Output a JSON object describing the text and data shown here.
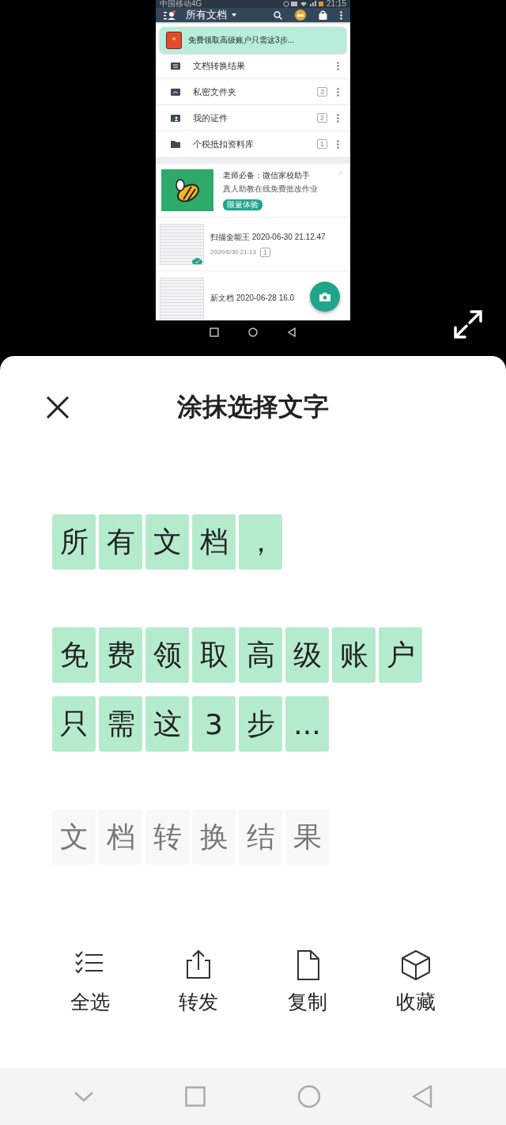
{
  "preview": {
    "status_bar": {
      "carrier": "中国移动4G",
      "time": "21:15"
    },
    "app_bar": {
      "title": "所有文档"
    },
    "promo": {
      "text": "免费领取高级账户只需这3步..."
    },
    "folders": [
      {
        "name": "文档转换结果",
        "kind": "convert"
      },
      {
        "name": "私密文件夹",
        "kind": "private",
        "count": "3"
      },
      {
        "name": "我的证件",
        "kind": "id",
        "count": "2"
      },
      {
        "name": "个税抵扣资料库",
        "kind": "folder",
        "count": "1"
      }
    ],
    "ad": {
      "title": "老师必备：微信家校助手",
      "subtitle": "真人助教在线免费批改作业",
      "button": "限量体验"
    },
    "documents": [
      {
        "title": "扫描全能王 2020-06-30 21.12.47",
        "meta": "2020/6/30 21:13",
        "count": "1",
        "synced": true
      },
      {
        "title": "新文档 2020-06-28 16.0",
        "synced": false
      }
    ]
  },
  "sheet": {
    "title": "涂抹选择文字",
    "paragraphs": [
      {
        "lines": [
          [
            {
              "text": "所",
              "selected": true
            },
            {
              "text": "有",
              "selected": true
            },
            {
              "text": "文",
              "selected": true
            },
            {
              "text": "档",
              "selected": true
            },
            {
              "text": "，",
              "selected": true
            }
          ]
        ]
      },
      {
        "lines": [
          [
            {
              "text": "免",
              "selected": true
            },
            {
              "text": "费",
              "selected": true
            },
            {
              "text": "领",
              "selected": true
            },
            {
              "text": "取",
              "selected": true
            },
            {
              "text": "高",
              "selected": true
            },
            {
              "text": "级",
              "selected": true
            },
            {
              "text": "账",
              "selected": true
            },
            {
              "text": "户",
              "selected": true
            }
          ],
          [
            {
              "text": "只",
              "selected": true
            },
            {
              "text": "需",
              "selected": true
            },
            {
              "text": "这",
              "selected": true
            },
            {
              "text": "3",
              "selected": true
            },
            {
              "text": "步",
              "selected": true
            },
            {
              "text": "...",
              "selected": true
            }
          ]
        ]
      },
      {
        "lines": [
          [
            {
              "text": "文",
              "selected": false
            },
            {
              "text": "档",
              "selected": false
            },
            {
              "text": "转",
              "selected": false
            },
            {
              "text": "换",
              "selected": false
            },
            {
              "text": "结",
              "selected": false
            },
            {
              "text": "果",
              "selected": false
            }
          ]
        ]
      }
    ],
    "actions": [
      {
        "label": "全选",
        "kind": "select_all"
      },
      {
        "label": "转发",
        "kind": "share"
      },
      {
        "label": "复制",
        "kind": "copy"
      },
      {
        "label": "收藏",
        "kind": "favorite"
      }
    ]
  }
}
